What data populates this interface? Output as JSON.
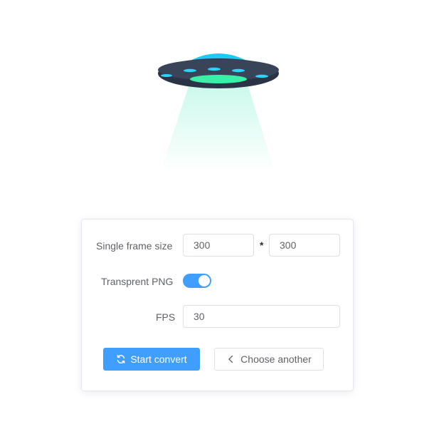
{
  "form": {
    "frame_size_label": "Single frame size",
    "width_value": "300",
    "height_value": "300",
    "separator": "*",
    "transparent_label": "Transprent PNG",
    "transparent_on": true,
    "fps_label": "FPS",
    "fps_value": "30"
  },
  "actions": {
    "start_label": "Start convert",
    "choose_label": "Choose another"
  },
  "colors": {
    "primary": "#409eff",
    "ufo_body": "#2b3446",
    "ufo_dome": "#1fc8f5",
    "ufo_lights": "#38f0a8",
    "beam": "#d8fbf0"
  },
  "icons": {
    "start": "refresh-icon",
    "choose": "chevron-left-icon"
  }
}
